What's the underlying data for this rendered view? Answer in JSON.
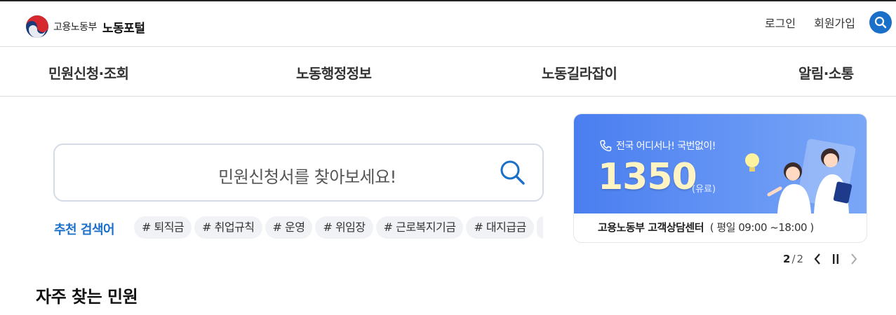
{
  "header": {
    "ministry": "고용노동부",
    "portal": "노동포털",
    "login": "로그인",
    "signup": "회원가입"
  },
  "gnb": {
    "items": [
      "민원신청·조회",
      "노동행정정보",
      "노동길라잡이",
      "알림·소통"
    ]
  },
  "search": {
    "placeholder": "민원신청서를 찾아보세요!",
    "recommend_label": "추천 검색어",
    "tags": [
      "# 퇴직금",
      "# 취업규칙",
      "# 운영",
      "# 위임장",
      "# 근로복지기금",
      "# 대지급금"
    ]
  },
  "banner": {
    "slogan": "전국 어디서나! 국번없이!",
    "number": "1350",
    "paid": "(유료)",
    "caption": "고용노동부 고객상담센터",
    "hours": "( 평일 09:00 ~18:00 )",
    "pager": {
      "current": "2",
      "separator": "/",
      "total": "2"
    }
  },
  "section": {
    "title": "자주 찾는 민원"
  },
  "colors": {
    "accent": "#1a6fc9",
    "banner_start": "#4a7ef0",
    "banner_end": "#7aa7f7"
  },
  "icons": [
    "government-emblem-icon",
    "search-icon",
    "phone-icon",
    "chevron-left-icon",
    "pause-icon",
    "chevron-right-icon"
  ]
}
